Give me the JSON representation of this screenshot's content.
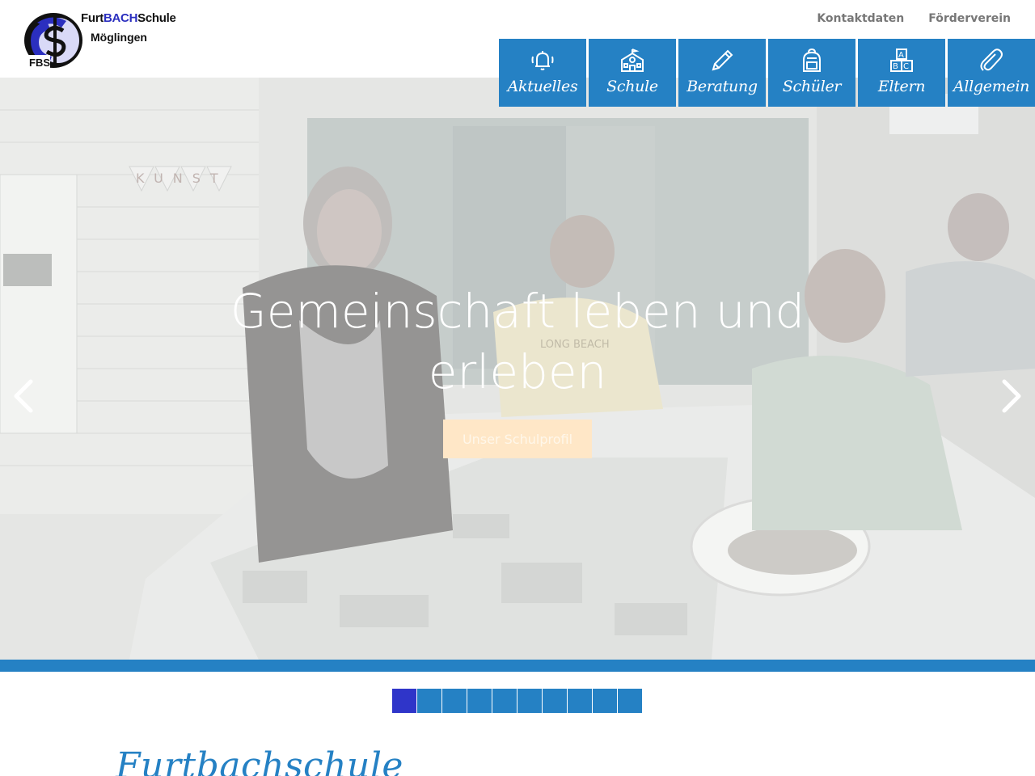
{
  "header": {
    "logo": {
      "name_prefix": "Furt",
      "name_accent": "BACH",
      "name_suffix": "Schule",
      "town": "Möglingen",
      "initials": "FBS"
    },
    "top_links": [
      {
        "label": "Kontaktdaten"
      },
      {
        "label": "Förderverein"
      }
    ]
  },
  "nav": {
    "items": [
      {
        "label": "Aktuelles",
        "icon": "bell-icon"
      },
      {
        "label": "Schule",
        "icon": "school-icon"
      },
      {
        "label": "Beratung",
        "icon": "pencil-icon"
      },
      {
        "label": "Schüler",
        "icon": "backpack-icon"
      },
      {
        "label": "Eltern",
        "icon": "abc-blocks-icon"
      },
      {
        "label": "Allgemein",
        "icon": "paperclip-icon"
      }
    ]
  },
  "hero": {
    "title_line1": "Gemeinschaft leben und",
    "title_line2": "erleben",
    "cta_label": "Unser Schulprofil",
    "banner_text": "KUNST",
    "shirt_text": "LONG BEACH"
  },
  "slider": {
    "count": 10,
    "active_index": 0
  },
  "section": {
    "title": "Furtbachschule"
  },
  "colors": {
    "brand_blue": "#2581c4",
    "active_dot": "#2f35c9",
    "cta_bg": "#ffe7c7"
  }
}
